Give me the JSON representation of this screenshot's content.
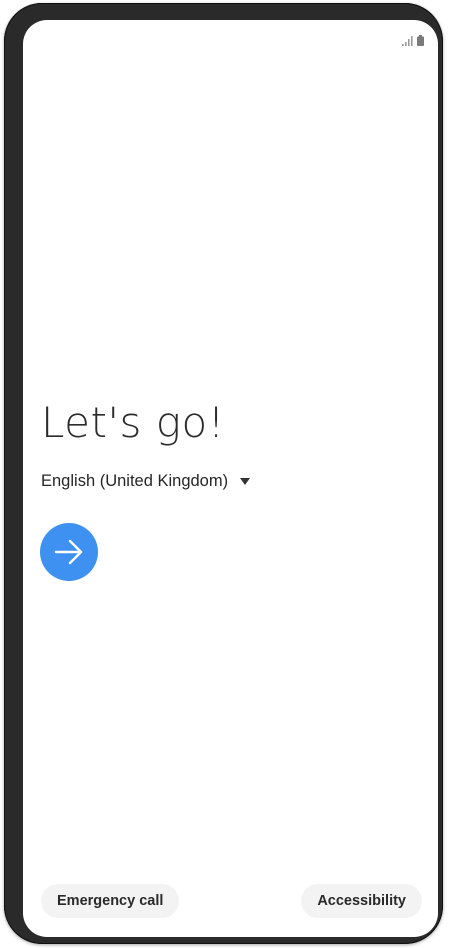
{
  "status_bar": {
    "icons": [
      "signal-icon",
      "battery-icon"
    ]
  },
  "setup": {
    "title": "Let's go!",
    "language": "English (United Kingdom)",
    "next_icon": "arrow-right-icon",
    "accent_color": "#3e91f1"
  },
  "footer": {
    "emergency_call_label": "Emergency call",
    "accessibility_label": "Accessibility"
  }
}
